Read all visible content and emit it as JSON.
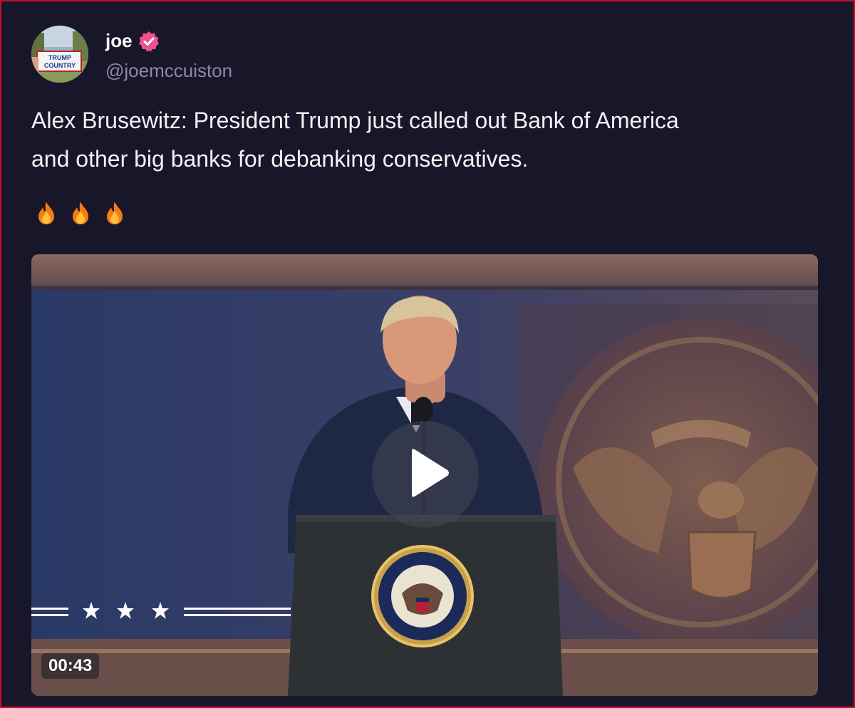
{
  "post": {
    "author": {
      "display_name": "joe",
      "handle": "@joemccuiston",
      "verified_icon": "verified-badge-icon",
      "avatar_sign": {
        "line1": "TRUMP",
        "line2": "COUNTRY"
      }
    },
    "text_line1": "Alex Brusewitz: President Trump just called out Bank of America",
    "text_line2": "and other big banks for debanking conservatives.",
    "reactions": [
      {
        "icon": "fire-icon"
      },
      {
        "icon": "fire-icon"
      },
      {
        "icon": "fire-icon"
      }
    ],
    "video": {
      "duration": "00:43",
      "play_icon": "play-icon"
    }
  },
  "colors": {
    "background": "#181629",
    "border": "#c8102e",
    "verified_badge": "#f0508c",
    "handle_text": "#8d8ba3"
  }
}
